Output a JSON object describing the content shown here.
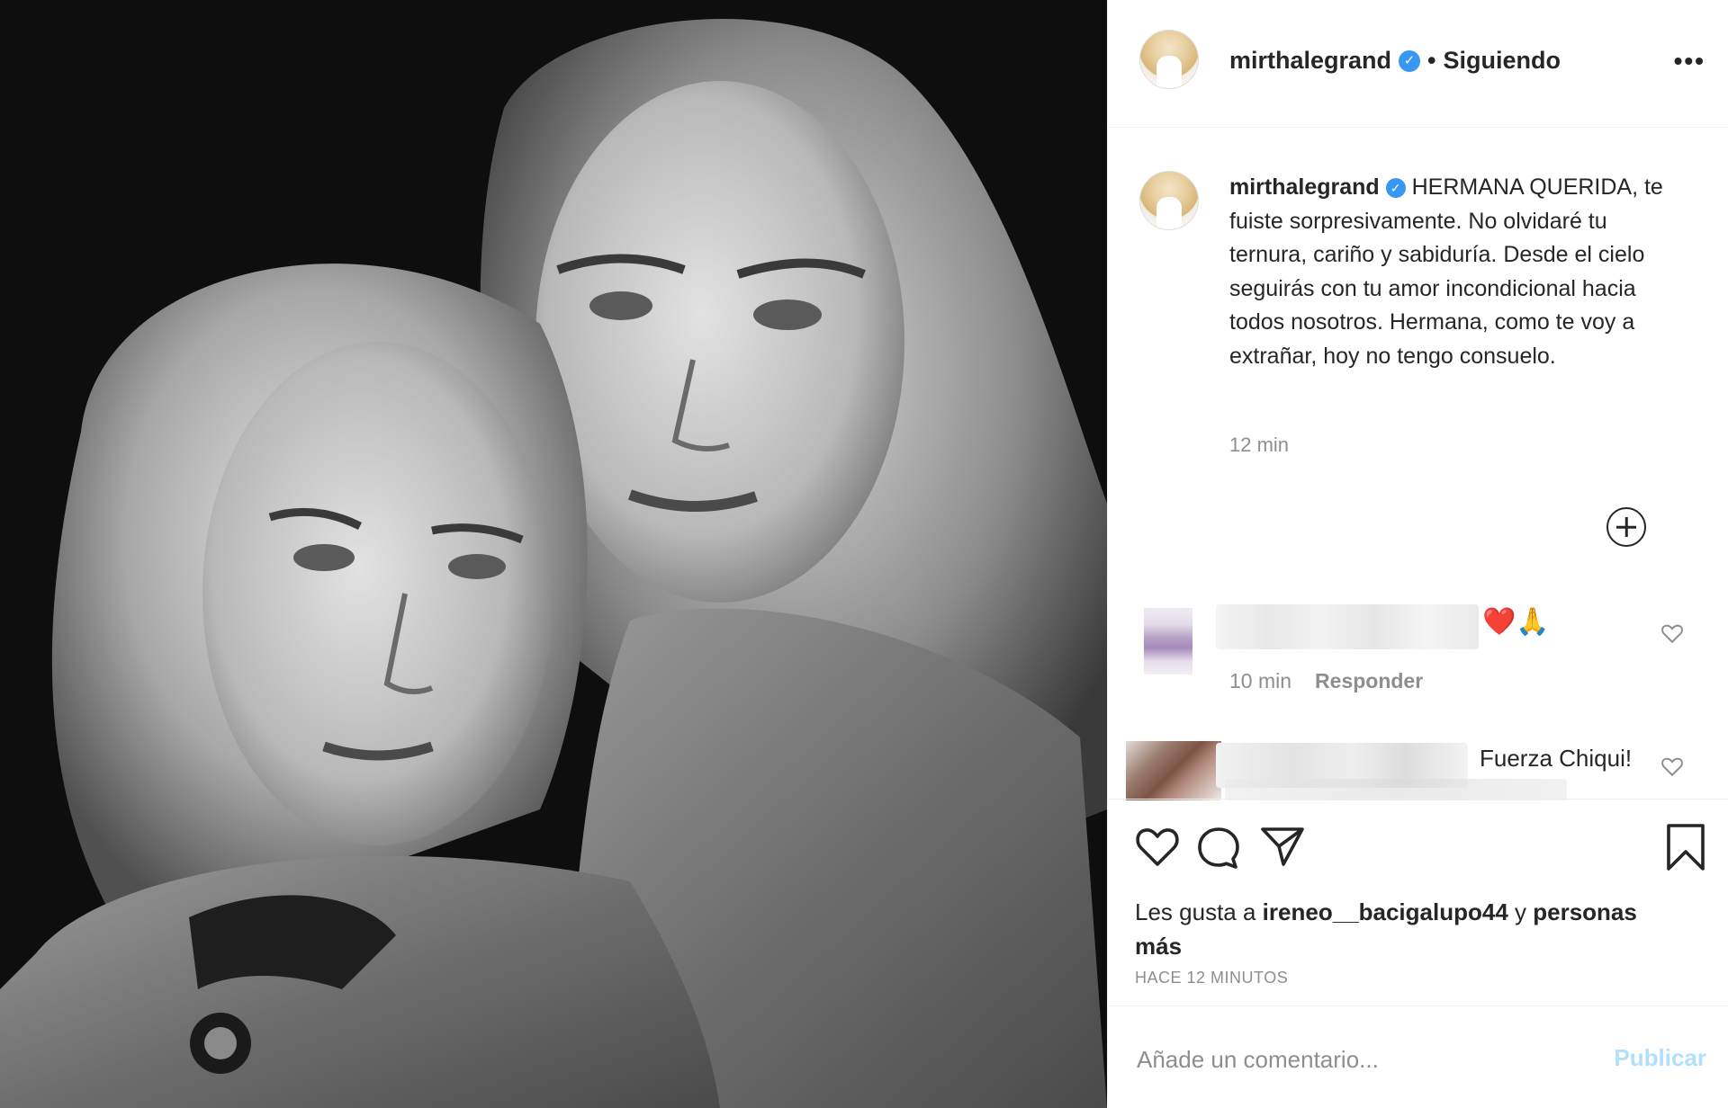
{
  "header": {
    "username": "mirthalegrand",
    "separator": "•",
    "follow_status": "Siguiendo",
    "more": "•••"
  },
  "caption": {
    "username": "mirthalegrand",
    "text": "HERMANA QUERIDA, te fuiste sorpresivamente. No olvidaré tu ternura, cariño y sabiduría. Desde el cielo seguirás con tu amor incondicional hacia todos nosotros. Hermana, como te voy a extrañar, hoy no tengo consuelo.",
    "time": "12 min"
  },
  "comments": [
    {
      "text": "❤️🙏",
      "time": "10 min",
      "reply_label": "Responder"
    },
    {
      "text": "Fuerza Chiqui!"
    }
  ],
  "likes": {
    "prefix": "Les gusta a",
    "user": "ireneo__bacigalupo44",
    "middle": "y",
    "suffix": "personas más"
  },
  "posted_ago": "HACE 12 MINUTOS",
  "add_comment": {
    "placeholder": "Añade un comentario...",
    "publish_label": "Publicar"
  },
  "colors": {
    "verified": "#3897f0",
    "publish_disabled": "#b2dffc",
    "muted": "#8e8e8e",
    "heart_red": "#e0162b"
  },
  "icons": [
    "more-icon",
    "verified-icon",
    "plus-circle-icon",
    "heart-icon",
    "comment-icon",
    "share-icon",
    "bookmark-icon"
  ]
}
